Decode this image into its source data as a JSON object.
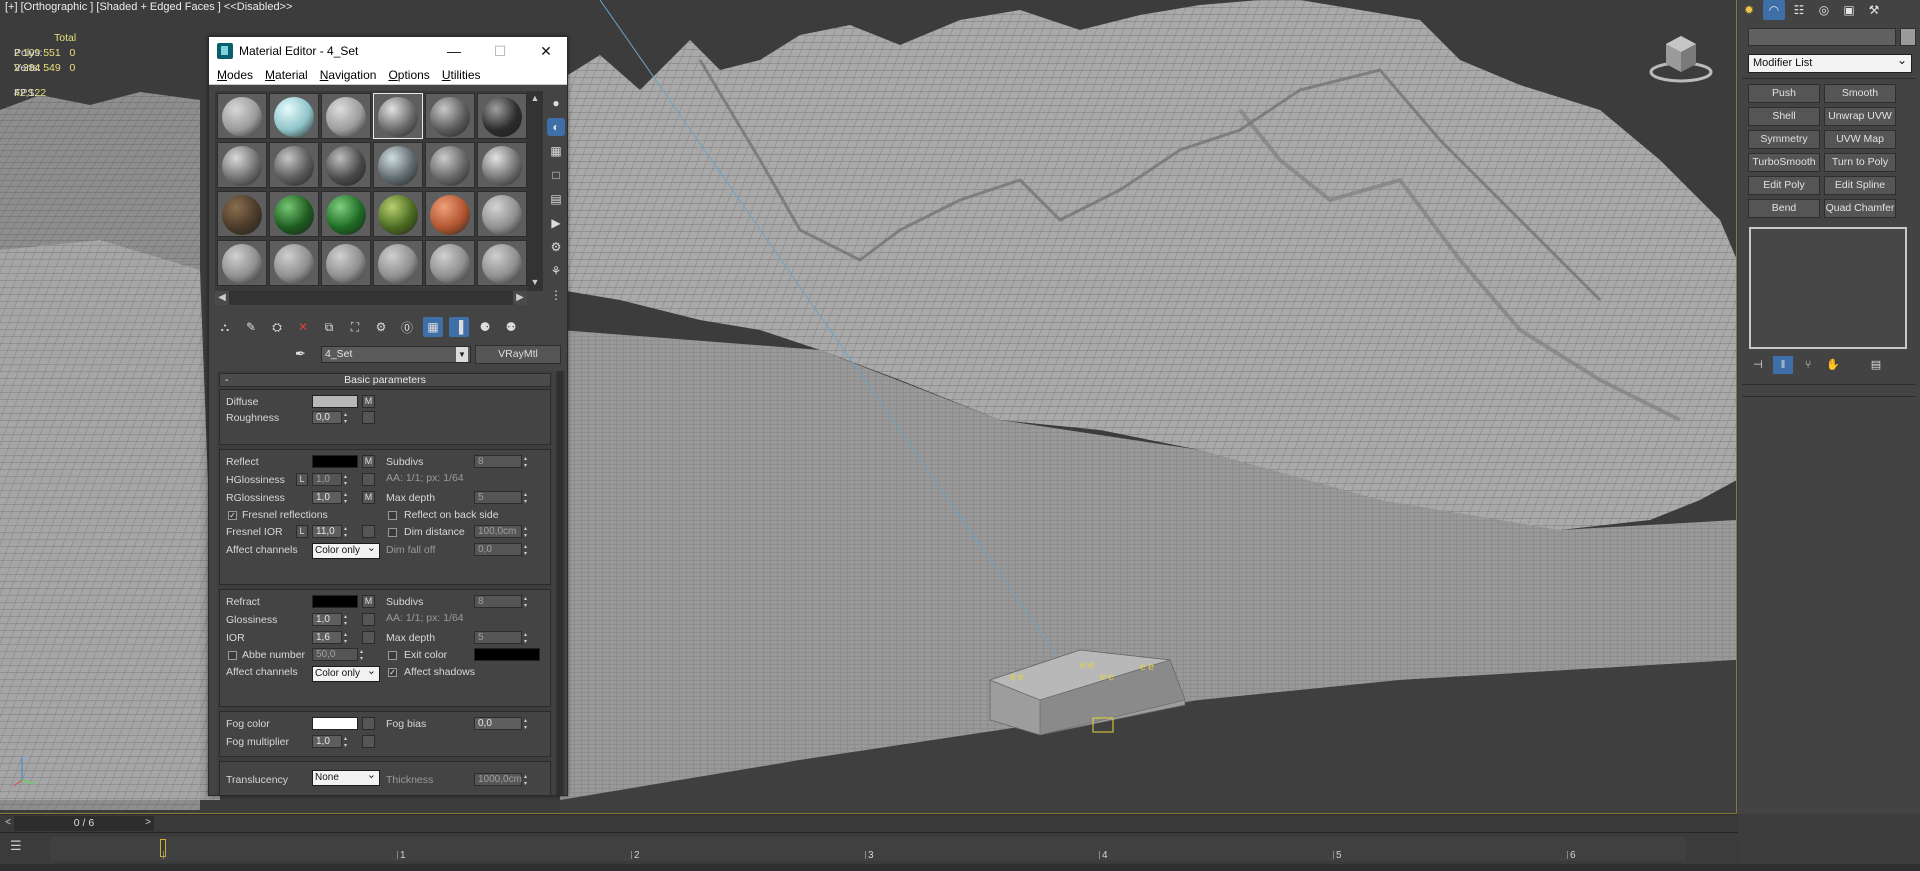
{
  "viewport": {
    "label": "[+] [Orthographic ] [Shaded + Edged Faces ]  <<Disabled>>",
    "stats": {
      "header": "Total",
      "polys_label": "Polys:",
      "polys_value": "2 109 551",
      "polys_sel": "0",
      "verts_label": "Verts:",
      "verts_value": "2 284 549",
      "verts_sel": "0",
      "fps_label": "FPS:",
      "fps_value": "42,122"
    }
  },
  "material_editor": {
    "title": "Material Editor - 4_Set",
    "menus": [
      "Modes",
      "Material",
      "Navigation",
      "Options",
      "Utilities"
    ],
    "slots": [
      {
        "color": "#9a9a9a",
        "hl": "#d8d8d8"
      },
      {
        "color": "#8fc4c8",
        "hl": "#e6fbfc"
      },
      {
        "color": "#9c9c9c",
        "hl": "#dcdcdc"
      },
      {
        "color": "#6a6a6a",
        "hl": "#e2e2e2"
      },
      {
        "color": "#5c5c5c",
        "hl": "#c8c8c8"
      },
      {
        "color": "#2c2c2c",
        "hl": "#a0a0a0"
      },
      {
        "color": "#707070",
        "hl": "#dadada"
      },
      {
        "color": "#5a5a5a",
        "hl": "#c6c6c6"
      },
      {
        "color": "#4a4a4a",
        "hl": "#bdbdbd"
      },
      {
        "color": "#5f6a6e",
        "hl": "#d0dde0"
      },
      {
        "color": "#666666",
        "hl": "#cccccc"
      },
      {
        "color": "#727272",
        "hl": "#e4e4e4"
      },
      {
        "color": "#4a3a2a",
        "hl": "#8a6e4e"
      },
      {
        "color": "#1e5a1e",
        "hl": "#76c776"
      },
      {
        "color": "#1e6a24",
        "hl": "#7fd07f"
      },
      {
        "color": "#4a6a20",
        "hl": "#b8d070"
      },
      {
        "color": "#b0552f",
        "hl": "#f0a07a"
      },
      {
        "color": "#8f8f8f",
        "hl": "#d4d4d4"
      },
      {
        "color": "#8e8e8e",
        "hl": "#d0d0d0"
      },
      {
        "color": "#8e8e8e",
        "hl": "#d0d0d0"
      },
      {
        "color": "#8e8e8e",
        "hl": "#d0d0d0"
      },
      {
        "color": "#8e8e8e",
        "hl": "#d0d0d0"
      },
      {
        "color": "#8e8e8e",
        "hl": "#d0d0d0"
      },
      {
        "color": "#8e8e8e",
        "hl": "#d0d0d0"
      }
    ],
    "material_name": "4_Set",
    "material_type": "VRayMtl",
    "rollout_title": "Basic parameters",
    "diffuse": {
      "label": "Diffuse",
      "color": "#b9b9b9",
      "map": "M"
    },
    "roughness": {
      "label": "Roughness",
      "value": "0,0"
    },
    "reflect": {
      "label": "Reflect",
      "color": "#000000",
      "map": "M",
      "subdivs_label": "Subdivs",
      "subdivs": "8",
      "aa": "AA: 1/1; px: 1/64"
    },
    "hglossiness": {
      "label": "HGlossiness",
      "lock": "L",
      "value": "1,0"
    },
    "rglossiness": {
      "label": "RGlossiness",
      "value": "1,0",
      "map": "M",
      "maxdepth_label": "Max depth",
      "maxdepth": "5"
    },
    "fresnel": {
      "label": "Fresnel reflections",
      "checked": "✓",
      "backside_label": "Reflect on back side"
    },
    "fresnel_ior": {
      "label": "Fresnel IOR",
      "lock": "L",
      "value": "11,0",
      "dimdist_label": "Dim distance",
      "dimdist": "100,0cm"
    },
    "affect_reflect": {
      "label": "Affect channels",
      "value": "Color only",
      "dimfall_label": "Dim fall off",
      "dimfall": "0,0"
    },
    "refract": {
      "label": "Refract",
      "color": "#000000",
      "map": "M",
      "subdivs_label": "Subdivs",
      "subdivs": "8",
      "aa": "AA: 1/1; px: 1/64"
    },
    "glossiness": {
      "label": "Glossiness",
      "value": "1,0"
    },
    "ior": {
      "label": "IOR",
      "value": "1,6",
      "maxdepth_label": "Max depth",
      "maxdepth": "5"
    },
    "abbe": {
      "label": "Abbe number",
      "value": "50,0",
      "exit_label": "Exit color",
      "exit_color": "#000000"
    },
    "affect_refract": {
      "label": "Affect channels",
      "value": "Color only",
      "shadows_label": "Affect shadows",
      "checked": "✓"
    },
    "fog": {
      "label": "Fog color",
      "color": "#ffffff",
      "bias_label": "Fog bias",
      "bias": "0,0",
      "mult_label": "Fog multiplier",
      "mult": "1,0"
    },
    "translucency": {
      "label": "Translucency",
      "value": "None",
      "thickness_label": "Thickness",
      "thickness": "1000,0cm"
    }
  },
  "command_panel": {
    "modifier_list": "Modifier List",
    "buttons": [
      "Push",
      "Smooth",
      "Shell",
      "Unwrap UVW",
      "Symmetry",
      "UVW Map",
      "TurboSmooth",
      "Turn to Poly",
      "Edit Poly",
      "Edit Spline",
      "Bend",
      "Quad Chamfer"
    ]
  },
  "timeline": {
    "frame": "0 / 6",
    "ticks": [
      "1",
      "2",
      "3",
      "4",
      "5",
      "6"
    ],
    "cursor": "0"
  }
}
